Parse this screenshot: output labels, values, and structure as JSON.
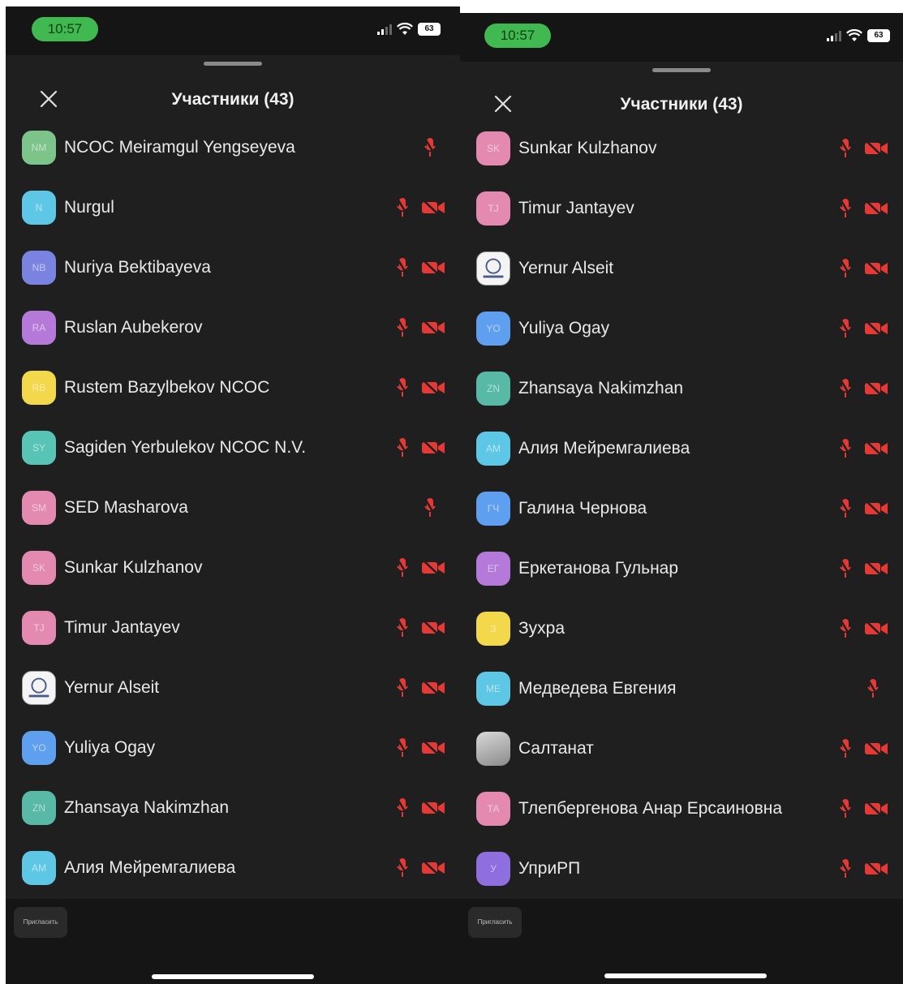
{
  "colors": {
    "background": "#1f1f1f",
    "status_bar": "#151515",
    "time_pill": "#3fb950",
    "muted_red": "#e53935",
    "text": "#e9e9e9"
  },
  "screens": [
    {
      "status": {
        "time": "10:57",
        "battery": "63"
      },
      "header": {
        "title": "Участники (43)",
        "close_icon": "close-icon"
      },
      "participants": [
        {
          "initials": "NM",
          "name": "NCOC Meiramgul Yengseyeva",
          "color": "#7cc48a",
          "mic_muted": true,
          "cam_off": false
        },
        {
          "initials": "N",
          "name": "Nurgul",
          "color": "#5ec7e6",
          "mic_muted": true,
          "cam_off": true
        },
        {
          "initials": "NB",
          "name": "Nuriya Bektibayeva",
          "color": "#7b83e0",
          "mic_muted": true,
          "cam_off": true
        },
        {
          "initials": "RA",
          "name": "Ruslan Aubekerov",
          "color": "#b57ad9",
          "mic_muted": true,
          "cam_off": true
        },
        {
          "initials": "RB",
          "name": "Rustem Bazylbekov NCOC",
          "color": "#f2d84a",
          "mic_muted": true,
          "cam_off": true
        },
        {
          "initials": "SY",
          "name": "Sagiden Yerbulekov NCOC N.V.",
          "color": "#57c4b6",
          "mic_muted": true,
          "cam_off": true
        },
        {
          "initials": "SM",
          "name": "SED Masharova",
          "color": "#e48ab0",
          "mic_muted": true,
          "cam_off": false
        },
        {
          "initials": "SK",
          "name": "Sunkar Kulzhanov",
          "color": "#e48ab0",
          "mic_muted": true,
          "cam_off": true
        },
        {
          "initials": "TJ",
          "name": "Timur Jantayev",
          "color": "#e48ab0",
          "mic_muted": true,
          "cam_off": true
        },
        {
          "initials": "",
          "name": "Yernur Alseit",
          "color": "photo",
          "mic_muted": true,
          "cam_off": true
        },
        {
          "initials": "YO",
          "name": "Yuliya Ogay",
          "color": "#5f9ff0",
          "mic_muted": true,
          "cam_off": true
        },
        {
          "initials": "ZN",
          "name": "Zhansaya Nakimzhan",
          "color": "#57b9a6",
          "mic_muted": true,
          "cam_off": true
        },
        {
          "initials": "AM",
          "name": "Алия Мейремгалиева",
          "color": "#5ec7e6",
          "mic_muted": true,
          "cam_off": true
        }
      ],
      "footer": {
        "invite_label": "Пригласить"
      }
    },
    {
      "status": {
        "time": "10:57",
        "battery": "63"
      },
      "header": {
        "title": "Участники (43)",
        "close_icon": "close-icon"
      },
      "participants": [
        {
          "initials": "SK",
          "name": "Sunkar Kulzhanov",
          "color": "#e48ab0",
          "mic_muted": true,
          "cam_off": true
        },
        {
          "initials": "TJ",
          "name": "Timur Jantayev",
          "color": "#e48ab0",
          "mic_muted": true,
          "cam_off": true
        },
        {
          "initials": "",
          "name": "Yernur Alseit",
          "color": "photo",
          "mic_muted": true,
          "cam_off": true
        },
        {
          "initials": "YO",
          "name": "Yuliya Ogay",
          "color": "#5f9ff0",
          "mic_muted": true,
          "cam_off": true
        },
        {
          "initials": "ZN",
          "name": "Zhansaya Nakimzhan",
          "color": "#57b9a6",
          "mic_muted": true,
          "cam_off": true
        },
        {
          "initials": "AM",
          "name": "Алия Мейремгалиева",
          "color": "#5ec7e6",
          "mic_muted": true,
          "cam_off": true
        },
        {
          "initials": "ГЧ",
          "name": "Галина Чернова",
          "color": "#5f9ff0",
          "mic_muted": true,
          "cam_off": true
        },
        {
          "initials": "ЕГ",
          "name": "Еркетанова Гульнар",
          "color": "#b57ad9",
          "mic_muted": true,
          "cam_off": true
        },
        {
          "initials": "З",
          "name": "Зухра",
          "color": "#f2d84a",
          "mic_muted": true,
          "cam_off": true
        },
        {
          "initials": "МЕ",
          "name": "Медведева Евгения",
          "color": "#5ec7e6",
          "mic_muted": true,
          "cam_off": false
        },
        {
          "initials": "",
          "name": "Салтанат",
          "color": "photo-gray",
          "mic_muted": true,
          "cam_off": true
        },
        {
          "initials": "ТА",
          "name": "Тлепбергенова Анар Ерсаиновна",
          "color": "#e48ab0",
          "mic_muted": true,
          "cam_off": true
        },
        {
          "initials": "У",
          "name": "УприРП",
          "color": "#8f6fe0",
          "mic_muted": true,
          "cam_off": true
        }
      ],
      "footer": {
        "invite_label": "Пригласить"
      }
    }
  ]
}
